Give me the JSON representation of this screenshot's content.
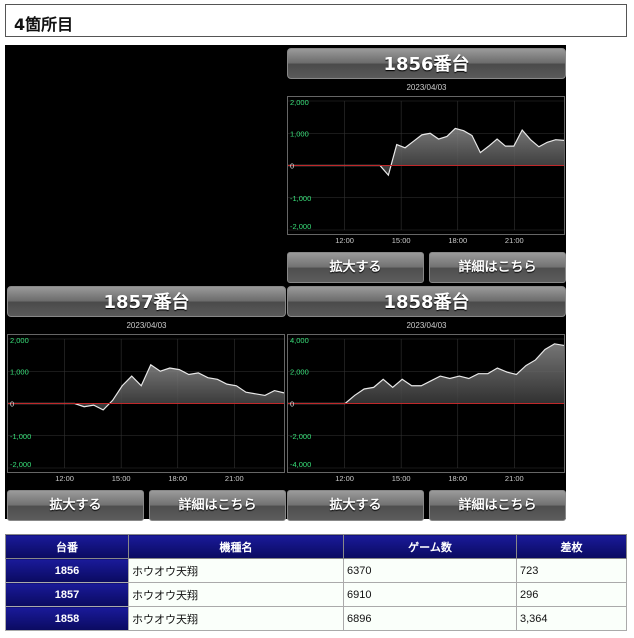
{
  "section_title": "4箇所目",
  "panels": [
    {
      "id": "p1856",
      "title": "1856番台",
      "date": "2023/04/03",
      "y_labels": [
        "2,000",
        "1,000",
        "0",
        "-1,000",
        "-2,000"
      ],
      "x_labels": [
        "12:00",
        "15:00",
        "18:00",
        "21:00"
      ],
      "expand_label": "拡大する",
      "detail_label": "詳細はこちら",
      "chart_data": {
        "type": "area",
        "ylim": [
          -2000,
          2000
        ],
        "values": [
          0,
          0,
          0,
          0,
          0,
          0,
          0,
          0,
          0,
          0,
          0,
          0,
          -300,
          650,
          550,
          750,
          950,
          1000,
          820,
          900,
          1150,
          1080,
          930,
          400,
          600,
          820,
          600,
          600,
          1100,
          800,
          580,
          720,
          800,
          780
        ]
      }
    },
    {
      "id": "p1857",
      "title": "1857番台",
      "date": "2023/04/03",
      "y_labels": [
        "2,000",
        "1,000",
        "0",
        "-1,000",
        "-2,000"
      ],
      "x_labels": [
        "12:00",
        "15:00",
        "18:00",
        "21:00"
      ],
      "expand_label": "拡大する",
      "detail_label": "詳細はこちら",
      "chart_data": {
        "type": "area",
        "ylim": [
          -2000,
          2000
        ],
        "values": [
          0,
          0,
          0,
          0,
          0,
          0,
          0,
          0,
          -100,
          -50,
          -200,
          100,
          550,
          850,
          550,
          1200,
          1000,
          1100,
          1050,
          900,
          950,
          800,
          750,
          600,
          550,
          350,
          300,
          250,
          400,
          330
        ]
      }
    },
    {
      "id": "p1858",
      "title": "1858番台",
      "date": "2023/04/03",
      "y_labels": [
        "4,000",
        "2,000",
        "0",
        "-2,000",
        "-4,000"
      ],
      "x_labels": [
        "12:00",
        "15:00",
        "18:00",
        "21:00"
      ],
      "expand_label": "拡大する",
      "detail_label": "詳細はこちら",
      "chart_data": {
        "type": "area",
        "ylim": [
          -4000,
          4000
        ],
        "values": [
          0,
          0,
          0,
          0,
          0,
          0,
          0,
          500,
          900,
          1000,
          1500,
          1000,
          1500,
          1100,
          1100,
          1400,
          1700,
          1550,
          1700,
          1550,
          1850,
          1850,
          2200,
          1950,
          1800,
          2350,
          2700,
          3350,
          3700,
          3600
        ]
      }
    }
  ],
  "table": {
    "headers": [
      "台番",
      "機種名",
      "ゲーム数",
      "差枚"
    ],
    "rows": [
      [
        "1856",
        "ホウオウ天翔",
        "6370",
        "723"
      ],
      [
        "1857",
        "ホウオウ天翔",
        "6910",
        "296"
      ],
      [
        "1858",
        "ホウオウ天翔",
        "6896",
        "3,364"
      ]
    ]
  }
}
